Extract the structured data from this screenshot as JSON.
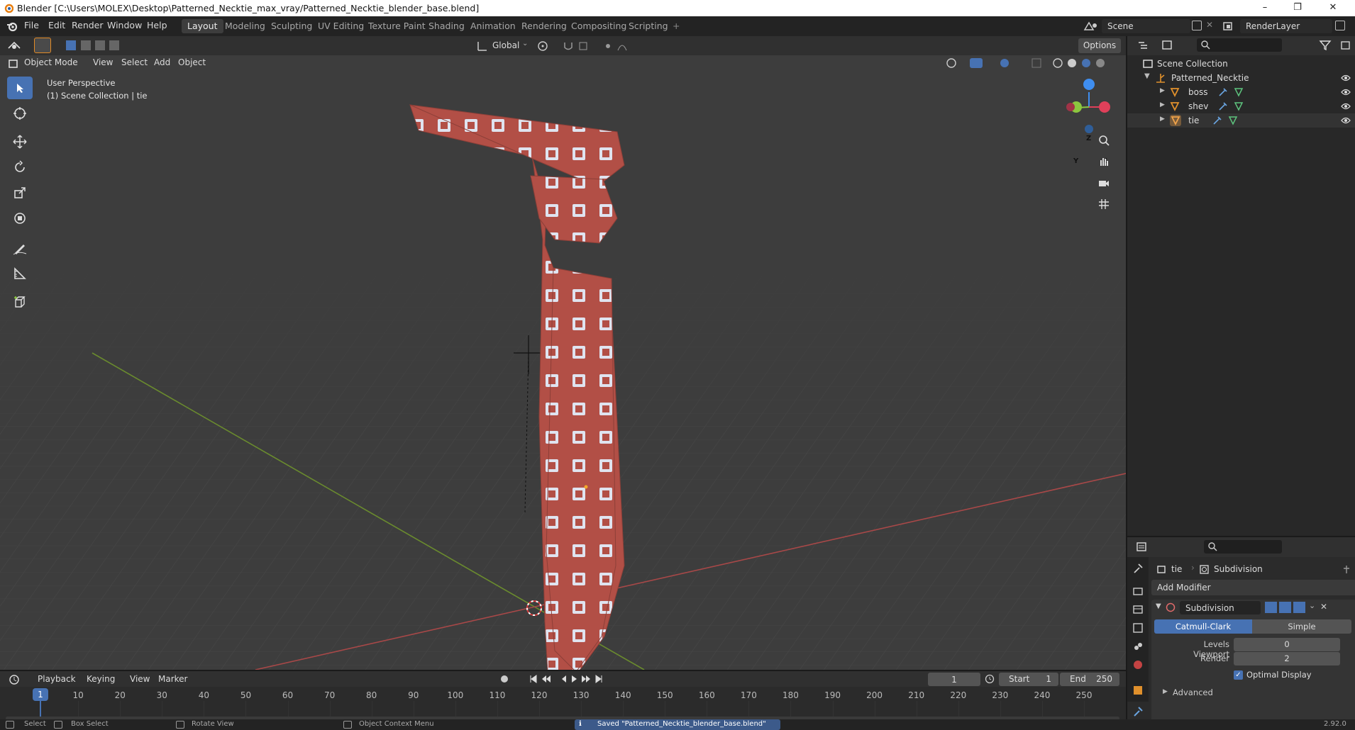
{
  "window": {
    "title": "Blender [C:\\Users\\MOLEX\\Desktop\\Patterned_Necktie_max_vray/Patterned_Necktie_blender_base.blend]",
    "minimize": "–",
    "maximize": "❐",
    "close": "✕"
  },
  "menu": {
    "items": [
      "File",
      "Edit",
      "Render",
      "Window",
      "Help"
    ]
  },
  "workspaces": {
    "tabs": [
      "Layout",
      "Modeling",
      "Sculpting",
      "UV Editing",
      "Texture Paint",
      "Shading",
      "Animation",
      "Rendering",
      "Compositing",
      "Scripting"
    ],
    "active": "Layout",
    "add": "+"
  },
  "scene": {
    "name": "Scene",
    "render_layer": "RenderLayer"
  },
  "viewport_header": {
    "transform_orientation": "Global",
    "options": "Options",
    "mode": "Object Mode",
    "menus": [
      "View",
      "Select",
      "Add",
      "Object"
    ]
  },
  "viewport": {
    "perspective": "User Perspective",
    "collection_info": "(1) Scene Collection | tie",
    "gizmo_axes": {
      "z": "Z",
      "y": "Y",
      "x": "X"
    },
    "axis_colors": {
      "x": "#e0405a",
      "y": "#8cc63f",
      "z": "#3f8ef0"
    },
    "tie_color": "#b24f46",
    "pattern_color": "#dfe3ef"
  },
  "outliner": {
    "root": "Scene Collection",
    "collection": "Patterned_Necktie",
    "objects": [
      "boss",
      "shev",
      "tie"
    ],
    "search_placeholder": ""
  },
  "properties": {
    "object_name": "tie",
    "modifier_breadcrumb": "Subdivision",
    "add_modifier": "Add Modifier",
    "modifier": {
      "name": "Subdivision",
      "types": [
        "Catmull-Clark",
        "Simple"
      ],
      "active_type": "Catmull-Clark",
      "levels_viewport_label": "Levels Viewport",
      "levels_viewport": "0",
      "render_label": "Render",
      "render": "2",
      "optimal_display_label": "Optimal Display",
      "optimal_display": true,
      "advanced_label": "Advanced"
    }
  },
  "timeline": {
    "menus": [
      "Playback",
      "Keying",
      "View",
      "Marker"
    ],
    "current_frame": "1",
    "start_label": "Start",
    "start": "1",
    "end_label": "End",
    "end": "250",
    "ticks": [
      "1",
      "10",
      "20",
      "30",
      "40",
      "50",
      "60",
      "70",
      "80",
      "90",
      "100",
      "110",
      "120",
      "130",
      "140",
      "150",
      "160",
      "170",
      "180",
      "190",
      "200",
      "210",
      "220",
      "230",
      "240",
      "250"
    ],
    "accent": "#4772b3"
  },
  "statusbar": {
    "select": "Select",
    "box_select": "Box Select",
    "rotate_view": "Rotate View",
    "context_menu": "Object Context Menu",
    "message": "Saved \"Patterned_Necktie_blender_base.blend\"",
    "version": "2.92.0"
  }
}
